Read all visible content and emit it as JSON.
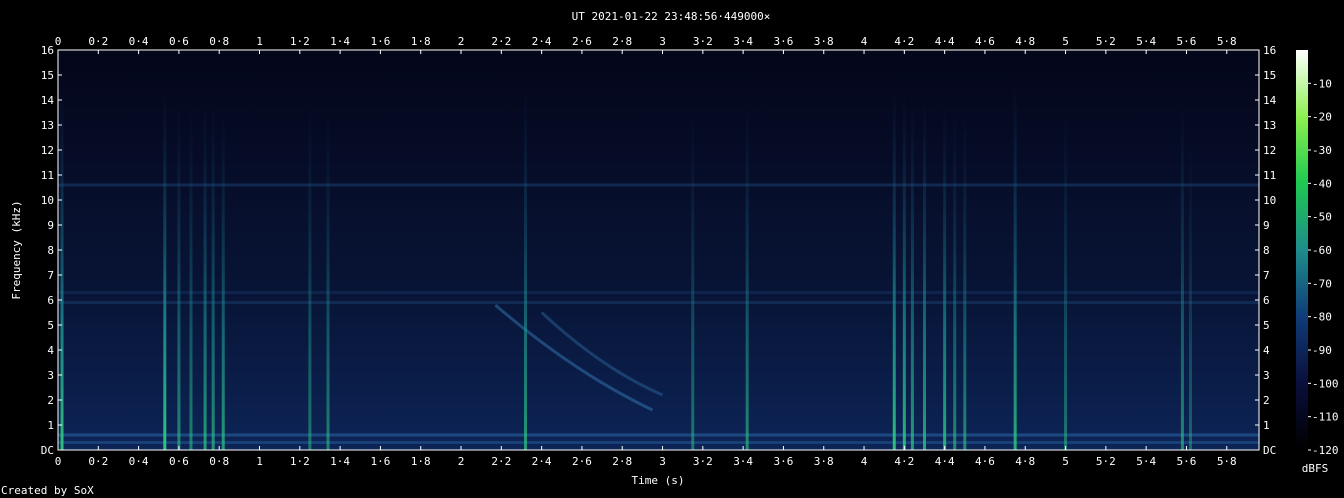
{
  "chart_data": {
    "type": "heatmap",
    "title": "UT 2021-01-22 23:48:56·449000×",
    "xlabel": "Time (s)",
    "ylabel": "Frequency (kHz)",
    "xlim": [
      0,
      5.96
    ],
    "ylim": [
      0,
      16
    ],
    "x_ticks": [
      "0",
      "0·2",
      "0·4",
      "0·6",
      "0·8",
      "1",
      "1·2",
      "1·4",
      "1·6",
      "1·8",
      "2",
      "2·2",
      "2·4",
      "2·6",
      "2·8",
      "3",
      "3·2",
      "3·4",
      "3·6",
      "3·8",
      "4",
      "4·2",
      "4·4",
      "4·6",
      "4·8",
      "5",
      "5·2",
      "5·4",
      "5·6",
      "5·8"
    ],
    "y_ticks": [
      "DC",
      "1",
      "2",
      "3",
      "4",
      "5",
      "6",
      "7",
      "8",
      "9",
      "10",
      "11",
      "12",
      "13",
      "14",
      "15",
      "16"
    ],
    "colorbar": {
      "label": "dBFS",
      "ticks": [
        "-10",
        "-20",
        "-30",
        "-40",
        "-50",
        "-60",
        "-70",
        "-80",
        "-90",
        "-100",
        "-110",
        "-120"
      ],
      "range": [
        -120,
        0
      ],
      "colors": [
        "#000000",
        "#0a0f3c",
        "#0f3c78",
        "#1e8c8c",
        "#1ec850",
        "#8cf050",
        "#ffffff"
      ]
    },
    "background_colors": [
      "#04061a",
      "#081436",
      "#0c2456"
    ],
    "horizontal_bands_khz": [
      {
        "freq": 0.6,
        "intensity": 0.55
      },
      {
        "freq": 10.6,
        "intensity": 0.3
      },
      {
        "freq": 5.9,
        "intensity": 0.25
      },
      {
        "freq": 6.3,
        "intensity": 0.18
      },
      {
        "freq": 0.3,
        "intensity": 0.4
      }
    ],
    "impulses": [
      {
        "t": 0.02,
        "top_khz": 14.5,
        "intensity": 0.9
      },
      {
        "t": 0.53,
        "top_khz": 14.5,
        "intensity": 0.95
      },
      {
        "t": 0.6,
        "top_khz": 14.0,
        "intensity": 0.6
      },
      {
        "t": 0.66,
        "top_khz": 13.8,
        "intensity": 0.55
      },
      {
        "t": 0.73,
        "top_khz": 14.0,
        "intensity": 0.7
      },
      {
        "t": 0.77,
        "top_khz": 14.0,
        "intensity": 0.65
      },
      {
        "t": 0.82,
        "top_khz": 13.5,
        "intensity": 0.7
      },
      {
        "t": 1.25,
        "top_khz": 14.0,
        "intensity": 0.5
      },
      {
        "t": 1.34,
        "top_khz": 13.5,
        "intensity": 0.55
      },
      {
        "t": 2.32,
        "top_khz": 14.5,
        "intensity": 0.7
      },
      {
        "t": 3.15,
        "top_khz": 13.5,
        "intensity": 0.5
      },
      {
        "t": 3.42,
        "top_khz": 14.0,
        "intensity": 0.6
      },
      {
        "t": 4.15,
        "top_khz": 14.5,
        "intensity": 0.9
      },
      {
        "t": 4.2,
        "top_khz": 14.3,
        "intensity": 0.85
      },
      {
        "t": 4.24,
        "top_khz": 14.0,
        "intensity": 0.7
      },
      {
        "t": 4.3,
        "top_khz": 14.2,
        "intensity": 0.75
      },
      {
        "t": 4.4,
        "top_khz": 13.8,
        "intensity": 0.8
      },
      {
        "t": 4.45,
        "top_khz": 13.5,
        "intensity": 0.6
      },
      {
        "t": 4.5,
        "top_khz": 13.5,
        "intensity": 0.6
      },
      {
        "t": 4.75,
        "top_khz": 14.8,
        "intensity": 0.8
      },
      {
        "t": 5.0,
        "top_khz": 13.5,
        "intensity": 0.5
      },
      {
        "t": 5.58,
        "top_khz": 14.0,
        "intensity": 0.6
      },
      {
        "t": 5.62,
        "top_khz": 12.5,
        "intensity": 0.4
      }
    ],
    "sweeps": [
      {
        "t0": 2.17,
        "f0_khz": 5.8,
        "t1": 2.95,
        "f1_khz": 1.6,
        "intensity": 0.45
      },
      {
        "t0": 2.4,
        "f0_khz": 5.5,
        "t1": 3.0,
        "f1_khz": 2.2,
        "intensity": 0.35
      }
    ]
  },
  "footer": {
    "credit": "Created by SoX"
  }
}
